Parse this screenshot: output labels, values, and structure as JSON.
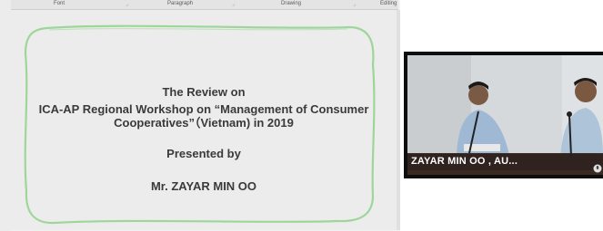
{
  "ribbon": {
    "groups": [
      "Font",
      "Paragraph",
      "Drawing",
      "Editing"
    ]
  },
  "slide": {
    "line1": "The Review on",
    "line2": "ICA-AP Regional Workshop on “Management of Consumer",
    "line3": "Cooperatives”（Vietnam) in 2019",
    "line4": "Presented by",
    "line5": "Mr. ZAYAR MIN OO"
  },
  "video": {
    "participant_name": "ZAYAR MIN OO , AU..."
  },
  "colors": {
    "slide_border": "#9ed69a",
    "slide_bg": "#ececec",
    "video_frame": "#0d0d0d"
  }
}
